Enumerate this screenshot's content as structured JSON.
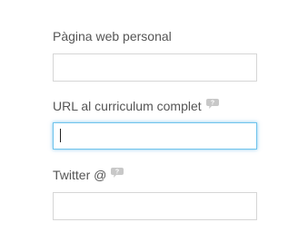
{
  "form": {
    "fields": [
      {
        "label": "Pàgina web personal",
        "value": "",
        "placeholder": "",
        "has_help": false,
        "focused": false
      },
      {
        "label": "URL al curriculum complet",
        "value": "",
        "placeholder": "",
        "has_help": true,
        "help_icon": "speech-bubble-question-icon",
        "focused": true
      },
      {
        "label": "Twitter @",
        "value": "",
        "placeholder": "",
        "has_help": true,
        "help_icon": "speech-bubble-question-icon",
        "focused": false
      }
    ]
  },
  "colors": {
    "label_text": "#555555",
    "input_border": "#d6d6d6",
    "focus_border": "#6ec3ec",
    "help_icon": "#c8c8c8"
  }
}
